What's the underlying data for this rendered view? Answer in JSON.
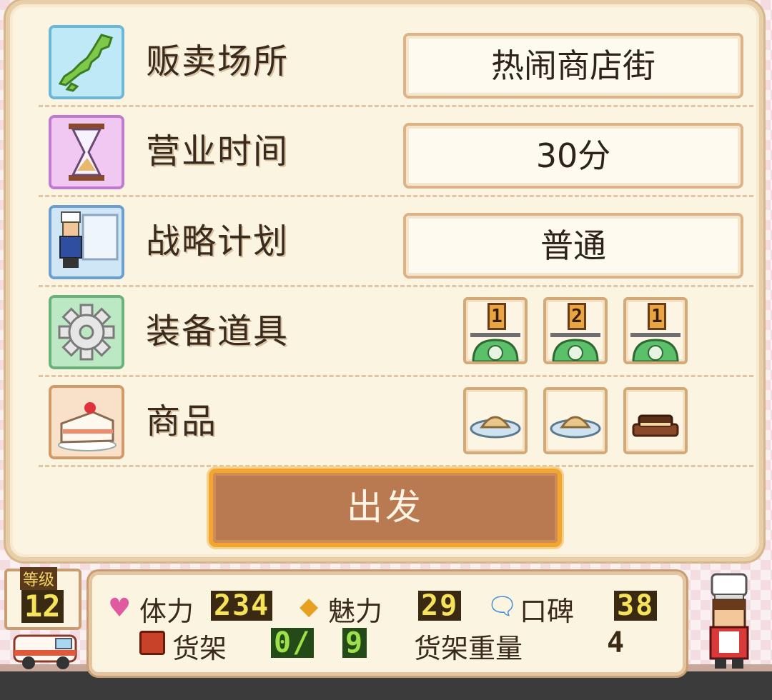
{
  "rows": [
    {
      "label": "贩卖场所",
      "value": "热闹商店街",
      "icon": "japan-map-icon"
    },
    {
      "label": "营业时间",
      "value": "30分",
      "icon": "hourglass-icon"
    },
    {
      "label": "战略计划",
      "value": "普通",
      "icon": "chef-board-icon"
    },
    {
      "label": "装备道具",
      "icon": "gear-icon"
    },
    {
      "label": "商品",
      "icon": "cake-icon"
    }
  ],
  "equipment": [
    {
      "level": "1",
      "icon": "scale-icon"
    },
    {
      "level": "2",
      "icon": "scale-icon"
    },
    {
      "level": "1",
      "icon": "scale-icon"
    }
  ],
  "products": [
    {
      "icon": "dumpling-plate-icon"
    },
    {
      "icon": "dumpling-plate-icon"
    },
    {
      "icon": "sandwich-cake-icon"
    }
  ],
  "start_button": "出发",
  "level": {
    "label": "等级",
    "value": "12"
  },
  "status": {
    "stamina_label": "体力",
    "stamina_value": "234",
    "charm_label": "魅力",
    "charm_value": "29",
    "reputation_label": "口碑",
    "reputation_value": "38",
    "shelf_label": "货架",
    "shelf_used": "0/",
    "shelf_total": "9",
    "shelf_weight_label": "货架重量",
    "shelf_weight_value": "4"
  },
  "colors": {
    "accent": "#f2a530",
    "button": "#b97a52",
    "panel": "#fbf4e1"
  }
}
